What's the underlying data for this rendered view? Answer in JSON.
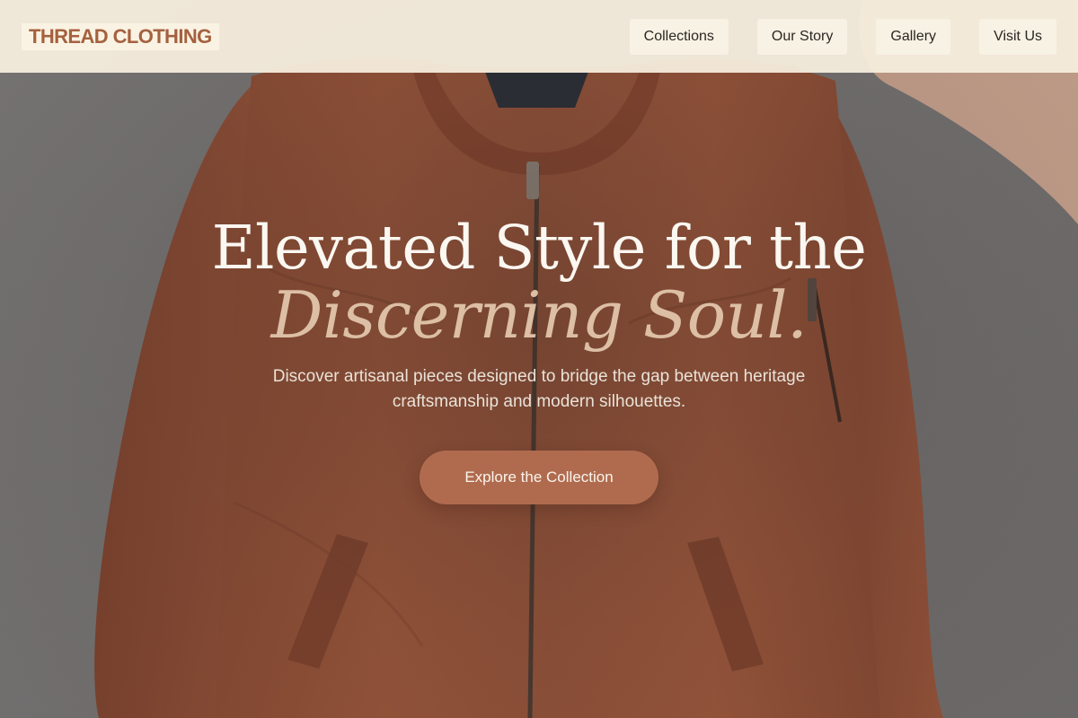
{
  "header": {
    "logo": "THREAD CLOTHING",
    "nav": [
      {
        "label": "Collections"
      },
      {
        "label": "Our Story"
      },
      {
        "label": "Gallery"
      },
      {
        "label": "Visit Us"
      }
    ]
  },
  "hero": {
    "headline_line1": "Elevated Style for the",
    "headline_line2": "Discerning Soul.",
    "subtitle": "Discover artisanal pieces designed to bridge the gap between heritage craftsmanship and modern silhouettes.",
    "cta_label": "Explore the Collection",
    "background_image": "rust-bomber-jacket-on-hanger"
  },
  "colors": {
    "accent": "#b06b4f",
    "logo": "#a5613f",
    "header_bg": "#f6eede",
    "headline": "#fbf7f1",
    "headline_accent": "#dcbfa5"
  }
}
